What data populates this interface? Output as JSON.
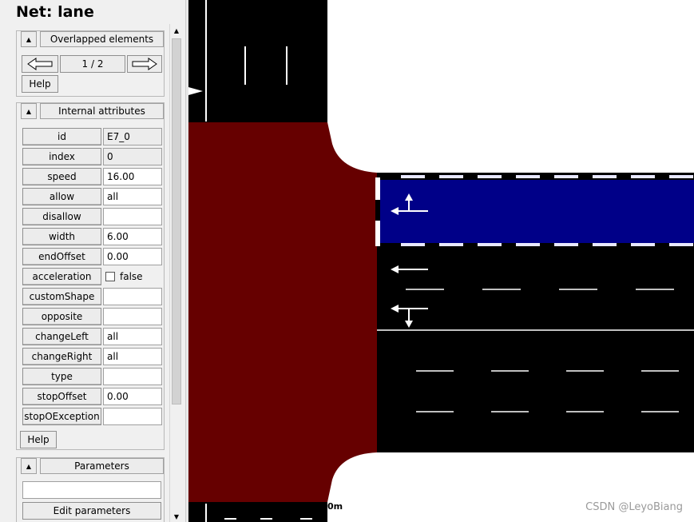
{
  "panel": {
    "title": "Net: lane",
    "overlap_group": {
      "label": "Overlapped elements",
      "counter": "1 / 2",
      "help_label": "Help"
    },
    "attr_group": {
      "label": "Internal attributes",
      "help_label": "Help",
      "rows": [
        {
          "key": "id",
          "value": "E7_0"
        },
        {
          "key": "index",
          "value": "0"
        },
        {
          "key": "speed",
          "value": "16.00"
        },
        {
          "key": "allow",
          "value": "all"
        },
        {
          "key": "disallow",
          "value": ""
        },
        {
          "key": "width",
          "value": "6.00"
        },
        {
          "key": "endOffset",
          "value": "0.00"
        },
        {
          "key": "acceleration",
          "value": "false"
        },
        {
          "key": "customShape",
          "value": ""
        },
        {
          "key": "opposite",
          "value": ""
        },
        {
          "key": "changeLeft",
          "value": "all"
        },
        {
          "key": "changeRight",
          "value": "all"
        },
        {
          "key": "type",
          "value": ""
        },
        {
          "key": "stopOffset",
          "value": "0.00"
        },
        {
          "key": "stopOException",
          "value": ""
        }
      ]
    },
    "param_group": {
      "label": "Parameters",
      "field_value": "",
      "edit_label": "Edit parameters"
    }
  },
  "canvas": {
    "scale_label": "0m",
    "watermark": "CSDN @LeyoBiang",
    "colors": {
      "background": "#ffffff",
      "road": "#000000",
      "junction": "#660000",
      "selected_lane": "#000088",
      "marking": "#ffffff"
    }
  }
}
